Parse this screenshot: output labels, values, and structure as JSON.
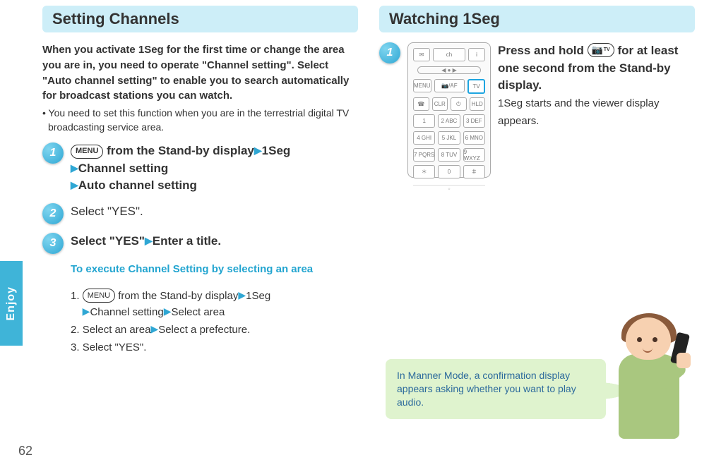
{
  "side_tab": "Enjoy",
  "page_number": "62",
  "left": {
    "title": "Setting Channels",
    "intro": "When you activate 1Seg for the first time or change the area you are in, you need to operate \"Channel setting\". Select \"Auto channel setting\" to enable you to search automatically for broadcast stations you can watch.",
    "note": "You need to set this function when you are in the terrestrial digital TV broadcasting service area.",
    "menu_label": "MENU",
    "steps": [
      {
        "num": "1",
        "line1_prefix": " from the Stand-by display",
        "path1": "1Seg",
        "path2": "Channel setting",
        "path3": "Auto channel setting"
      },
      {
        "num": "2",
        "text": "Select \"YES\"."
      },
      {
        "num": "3",
        "text_a": "Select \"YES\"",
        "text_b": "Enter a title.",
        "sub_title": "To execute Channel Setting by selecting an area",
        "items": [
          {
            "n": "1.",
            "a": " from the Stand-by display",
            "p1": "1Seg",
            "p2": "Channel setting",
            "p3": "Select area"
          },
          {
            "n": "2.",
            "a": "Select an area",
            "p1": "Select a prefecture."
          },
          {
            "n": "3.",
            "a": "Select \"YES\"."
          }
        ]
      }
    ]
  },
  "right": {
    "title": "Watching 1Seg",
    "step_num": "1",
    "cam_icon_label": "📷",
    "cam_sub": "TV",
    "line1_a": "Press and hold ",
    "line1_b": " for at least one second from the Stand-by display.",
    "line2": "1Seg starts and the viewer display appears.",
    "remote": {
      "dpad": "ch",
      "row_menu": [
        "MENU",
        "📷/AF",
        "TV"
      ],
      "row_clr": [
        "☎",
        "CLR",
        "⏻",
        "HLD"
      ],
      "keys": [
        [
          "1",
          "2 ABC",
          "3 DEF"
        ],
        [
          "4 GHI",
          "5 JKL",
          "6 MNO"
        ],
        [
          "7 PQRS",
          "8 TUV",
          "9 WXYZ"
        ],
        [
          "＊",
          "0",
          "＃"
        ]
      ]
    },
    "bubble": "In Manner Mode, a confirmation display appears asking whether you want to play audio."
  }
}
